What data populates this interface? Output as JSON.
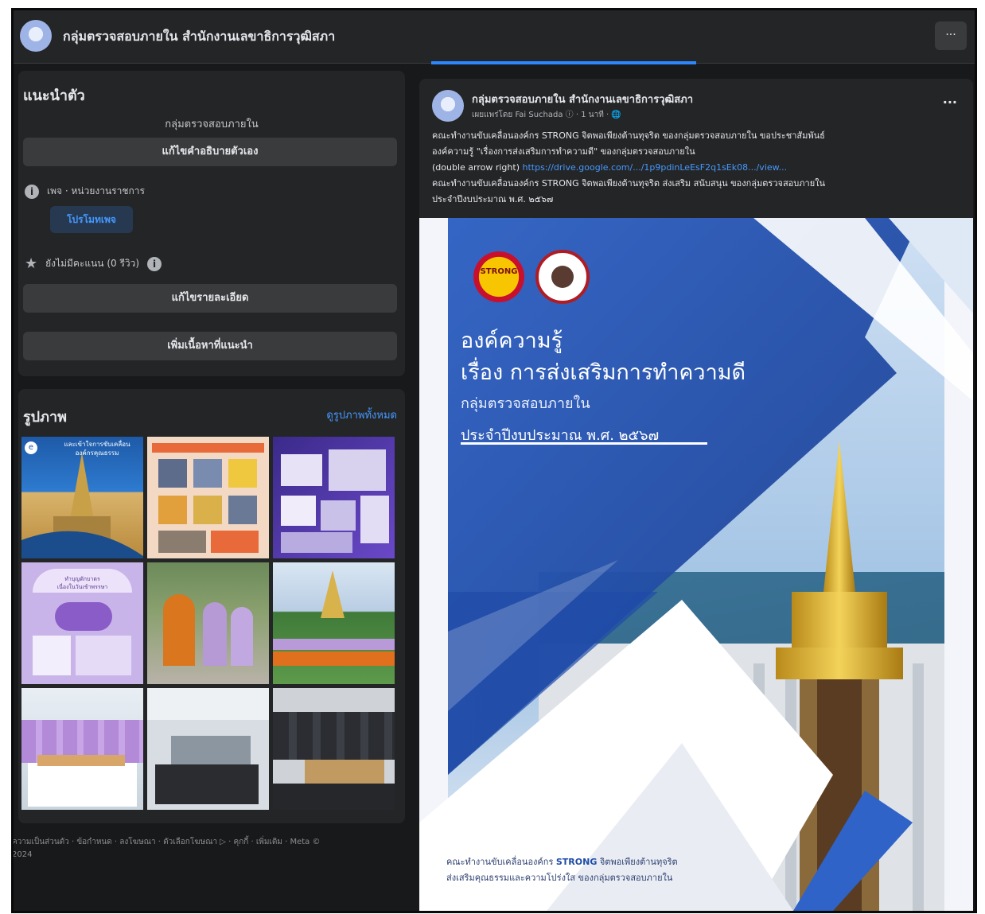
{
  "header": {
    "page_name": "กลุ่มตรวจสอบภายใน สำนักงานเลขาธิการวุฒิสภา",
    "more_label": "···"
  },
  "intro": {
    "title": "แนะนำตัว",
    "bio": "กลุ่มตรวจสอบภายใน",
    "edit_bio_label": "แก้ไขคำอธิบายตัวเอง",
    "category": "เพจ · หน่วยงานราชการ",
    "promote_label": "โปรโมทเพจ",
    "rating": "ยังไม่มีคะแนน (0 รีวิว)",
    "edit_details_label": "แก้ไขรายละเอียด",
    "add_featured_label": "เพิ่มเนื้อหาที่แนะนำ"
  },
  "photos": {
    "title": "รูปภาพ",
    "see_all": "ดูรูปภาพทั้งหมด",
    "tile1_caption_1": "และเข้าใจการขับเคลื่อน",
    "tile1_caption_2": "องค์กรคุณธรรม",
    "tile4_caption_1": "ทำบุญตักบาตร",
    "tile4_caption_2": "เนื่องในวันเข้าพรรษา"
  },
  "footer": {
    "line1": "ความเป็นส่วนตัว · ข้อกำหนด · ลงโฆษณา · ตัวเลือกโฆษณา ▷ · คุกกี้ · เพิ่มเติม · Meta ©",
    "line2": "2024"
  },
  "post": {
    "author": "กลุ่มตรวจสอบภายใน สำนักงานเลขาธิการวุฒิสภา",
    "meta": "เผยแพร่โดย Fai Suchada ⓘ · 1 นาที · 🌐",
    "more": "···",
    "line1": "คณะทำงานขับเคลื่อนองค์กร STRONG จิตพอเพียงต้านทุจริต ของกลุ่มตรวจสอบภายใน ขอประชาสัมพันธ์",
    "line2": "องค์ความรู้ \"เรื่องการส่งเสริมการทำความดี\" ของกลุ่มตรวจสอบภายใน",
    "line3_prefix": "(double arrow right) ",
    "line3_link": "https://drive.google.com/.../1p9pdinLeEsF2q1sEk08.../view...",
    "line4": "คณะทำงานขับเคลื่อนองค์กร STRONG จิตพอเพียงต้านทุจริต ส่งเสริม สนับสนุน ของกลุ่มตรวจสอบภายใน",
    "line5": "ประจำปีงบประมาณ พ.ศ. ๒๕๖๗"
  },
  "poster": {
    "logo1_text": "STRONG",
    "title1": "องค์ความรู้",
    "title2": "เรื่อง การส่งเสริมการทำความดี",
    "subtitle": "กลุ่มตรวจสอบภายใน",
    "fiscal": "ประจำปีงบประมาณ พ.ศ. ๒๕๖๗",
    "foot1_prefix": "คณะทำงานขับเคลื่อนองค์กร ",
    "foot1_bold": "STRONG",
    "foot1_suffix": " จิตพอเพียงต้านทุจริต",
    "foot2": "ส่งเสริมคุณธรรมและความโปร่งใส ของกลุ่มตรวจสอบภายใน"
  },
  "colors": {
    "background": "#18191a",
    "card": "#242526",
    "button": "#3a3b3c",
    "text": "#e4e6eb",
    "link": "#4599ff",
    "poster_blue": "#2f63c8"
  }
}
